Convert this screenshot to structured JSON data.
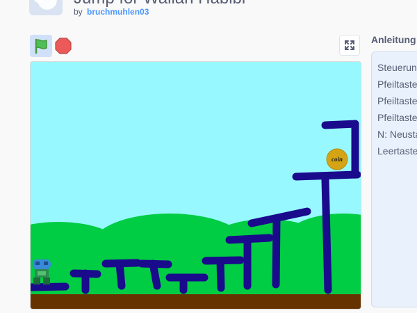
{
  "project": {
    "title": "Jump for Wallah Habibi",
    "by_label": "by",
    "author": "bruchmuhlen03"
  },
  "controls": {
    "green_flag_icon": "green-flag-icon",
    "stop_icon": "stop-sign-icon",
    "fullscreen_icon": "fullscreen-icon"
  },
  "stage": {
    "coin_label": "coin",
    "colors": {
      "sky": "#98f8ff",
      "hills": "#00cc44",
      "ground": "#663300",
      "platforms": "#1a0a8c",
      "coin": "#d4a415"
    }
  },
  "instructions": {
    "heading": "Anleitung",
    "lines": [
      "Steuerun",
      "Pfeiltaste",
      "Pfeiltaste",
      "Pfeiltaste",
      "N: Neusta",
      "Leertaste"
    ]
  }
}
